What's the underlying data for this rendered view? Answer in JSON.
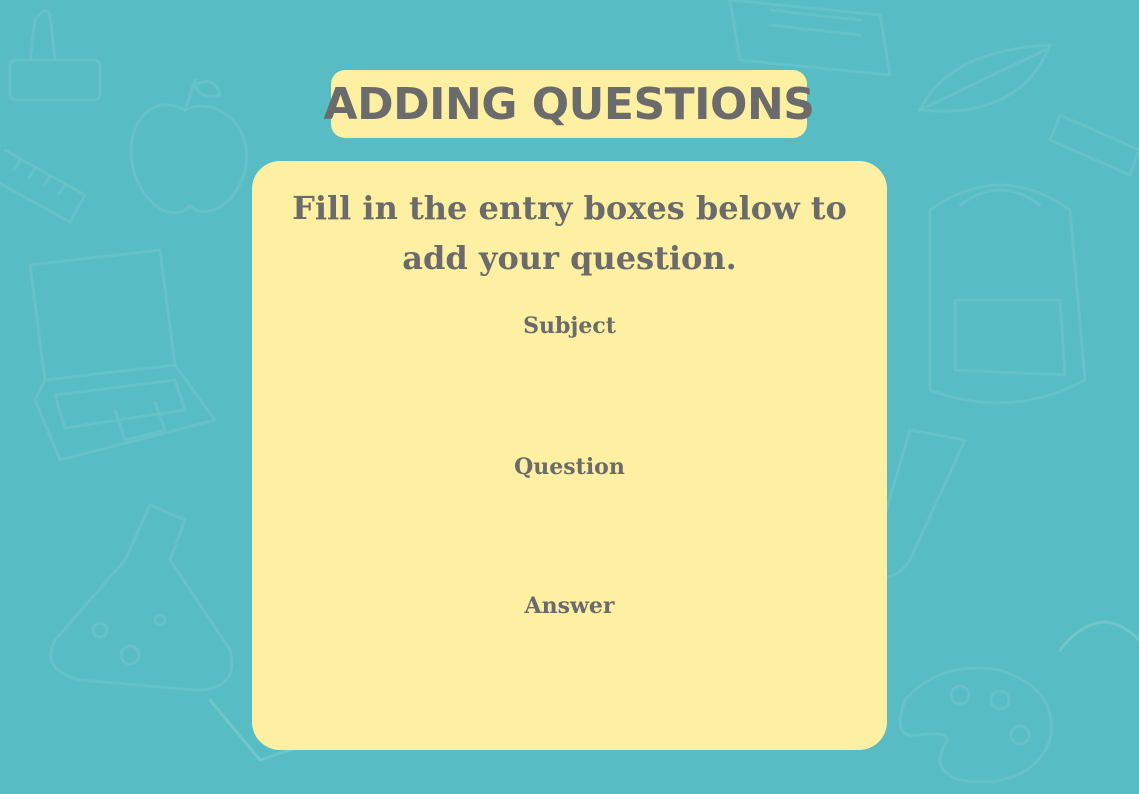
{
  "title": "ADDING QUESTIONS",
  "instructions_line1": "Fill in the entry boxes below to",
  "instructions_line2": "add your question.",
  "fields": [
    {
      "label": "Subject",
      "value": ""
    },
    {
      "label": "Question",
      "value": ""
    },
    {
      "label": "Answer",
      "value": ""
    }
  ],
  "background_doodle_icons": [
    "apple-icon",
    "ruler-icon",
    "laptop-icon",
    "backpack-icon",
    "flask-icon",
    "leaf-icon",
    "test-tube-icon",
    "palette-icon",
    "stamp-icon",
    "book-icon"
  ],
  "colors": {
    "background": "#58bcc4",
    "panel": "#fef0a3",
    "text": "#6b6b6b",
    "doodle": "#7fd0d2"
  }
}
